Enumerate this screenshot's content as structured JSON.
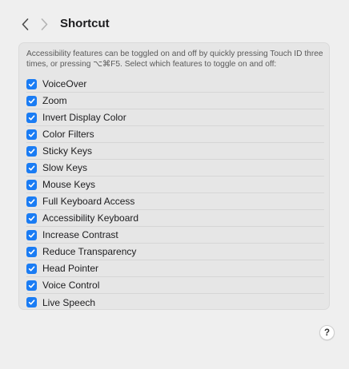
{
  "toolbar": {
    "back_icon": "chevron-left-icon",
    "forward_icon": "chevron-right-icon",
    "title": "Shortcut"
  },
  "panel": {
    "description": "Accessibility features can be toggled on and off by quickly pressing Touch ID three times, or pressing ⌥⌘F5. Select which features to toggle on and off:",
    "features": [
      {
        "label": "VoiceOver",
        "checked": true
      },
      {
        "label": "Zoom",
        "checked": true
      },
      {
        "label": "Invert Display Color",
        "checked": true
      },
      {
        "label": "Color Filters",
        "checked": true
      },
      {
        "label": "Sticky Keys",
        "checked": true
      },
      {
        "label": "Slow Keys",
        "checked": true
      },
      {
        "label": "Mouse Keys",
        "checked": true
      },
      {
        "label": "Full Keyboard Access",
        "checked": true
      },
      {
        "label": "Accessibility Keyboard",
        "checked": true
      },
      {
        "label": "Increase Contrast",
        "checked": true
      },
      {
        "label": "Reduce Transparency",
        "checked": true
      },
      {
        "label": "Head Pointer",
        "checked": true
      },
      {
        "label": "Voice Control",
        "checked": true
      },
      {
        "label": "Live Speech",
        "checked": true
      }
    ]
  },
  "help_button": {
    "label": "?"
  },
  "colors": {
    "accent": "#1a7cf4",
    "background": "#efefef",
    "panel": "#e6e6e6"
  }
}
